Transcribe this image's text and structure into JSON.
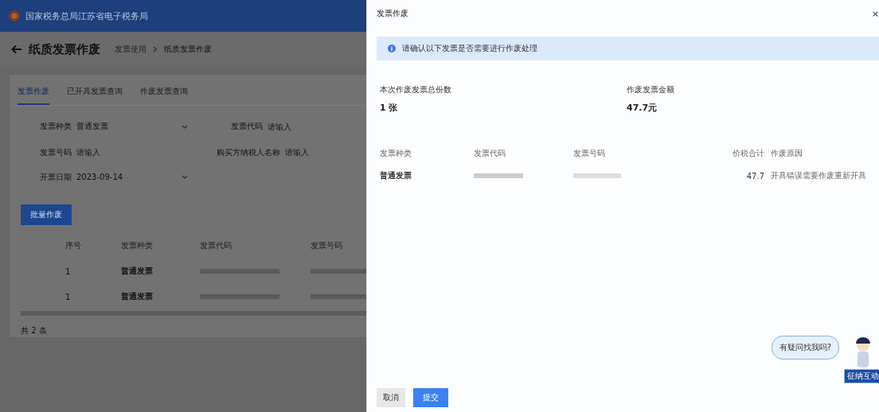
{
  "header": {
    "site_title": "国家税务总局江苏省电子税务局"
  },
  "page": {
    "title": "纸质发票作废",
    "breadcrumb": [
      "发票使用",
      "纸质发票作废"
    ]
  },
  "tabs": [
    {
      "label": "发票作废",
      "selected": true
    },
    {
      "label": "已开具发票查询",
      "selected": false
    },
    {
      "label": "作废发票查询",
      "selected": false
    }
  ],
  "form": [
    {
      "label": "发票种类",
      "value": "普通发票",
      "kind": "select"
    },
    {
      "label": "发票代码",
      "placeholder": "请输入",
      "kind": "input"
    },
    {
      "label": "发票号码",
      "placeholder": "请输入",
      "kind": "input"
    },
    {
      "label": "购买方纳税人名称",
      "placeholder": "请输入",
      "kind": "input"
    },
    {
      "label": "开票日期",
      "value": "2023-09-14",
      "kind": "select"
    }
  ],
  "batch_button": "批量作废",
  "table": {
    "columns": [
      "序号",
      "发票种类",
      "发票代码",
      "发票号码"
    ],
    "rows": [
      {
        "index": "1",
        "type": "普通发票"
      },
      {
        "index": "1",
        "type": "普通发票"
      }
    ]
  },
  "pagination": "共 2 条",
  "drawer": {
    "title": "发票作废",
    "close": "×",
    "notice": "请确认以下发票是否需要进行作废处理",
    "stats": [
      {
        "label": "本次作废发票总份数",
        "value": "1 张"
      },
      {
        "label": "作废发票金额",
        "value": "47.7元"
      }
    ],
    "columns": [
      "发票种类",
      "发票代码",
      "发票号码",
      "价税合计",
      "作废原因"
    ],
    "rows": [
      {
        "type": "普通发票",
        "amount": "47.7",
        "reason": "开具错误需要作废重新开具"
      }
    ],
    "buttons": [
      {
        "label": "取消",
        "primary": false
      },
      {
        "label": "提交",
        "primary": true
      }
    ]
  },
  "assistant": {
    "bubble": "有疑问找我吗?",
    "badge": "征纳互动"
  }
}
